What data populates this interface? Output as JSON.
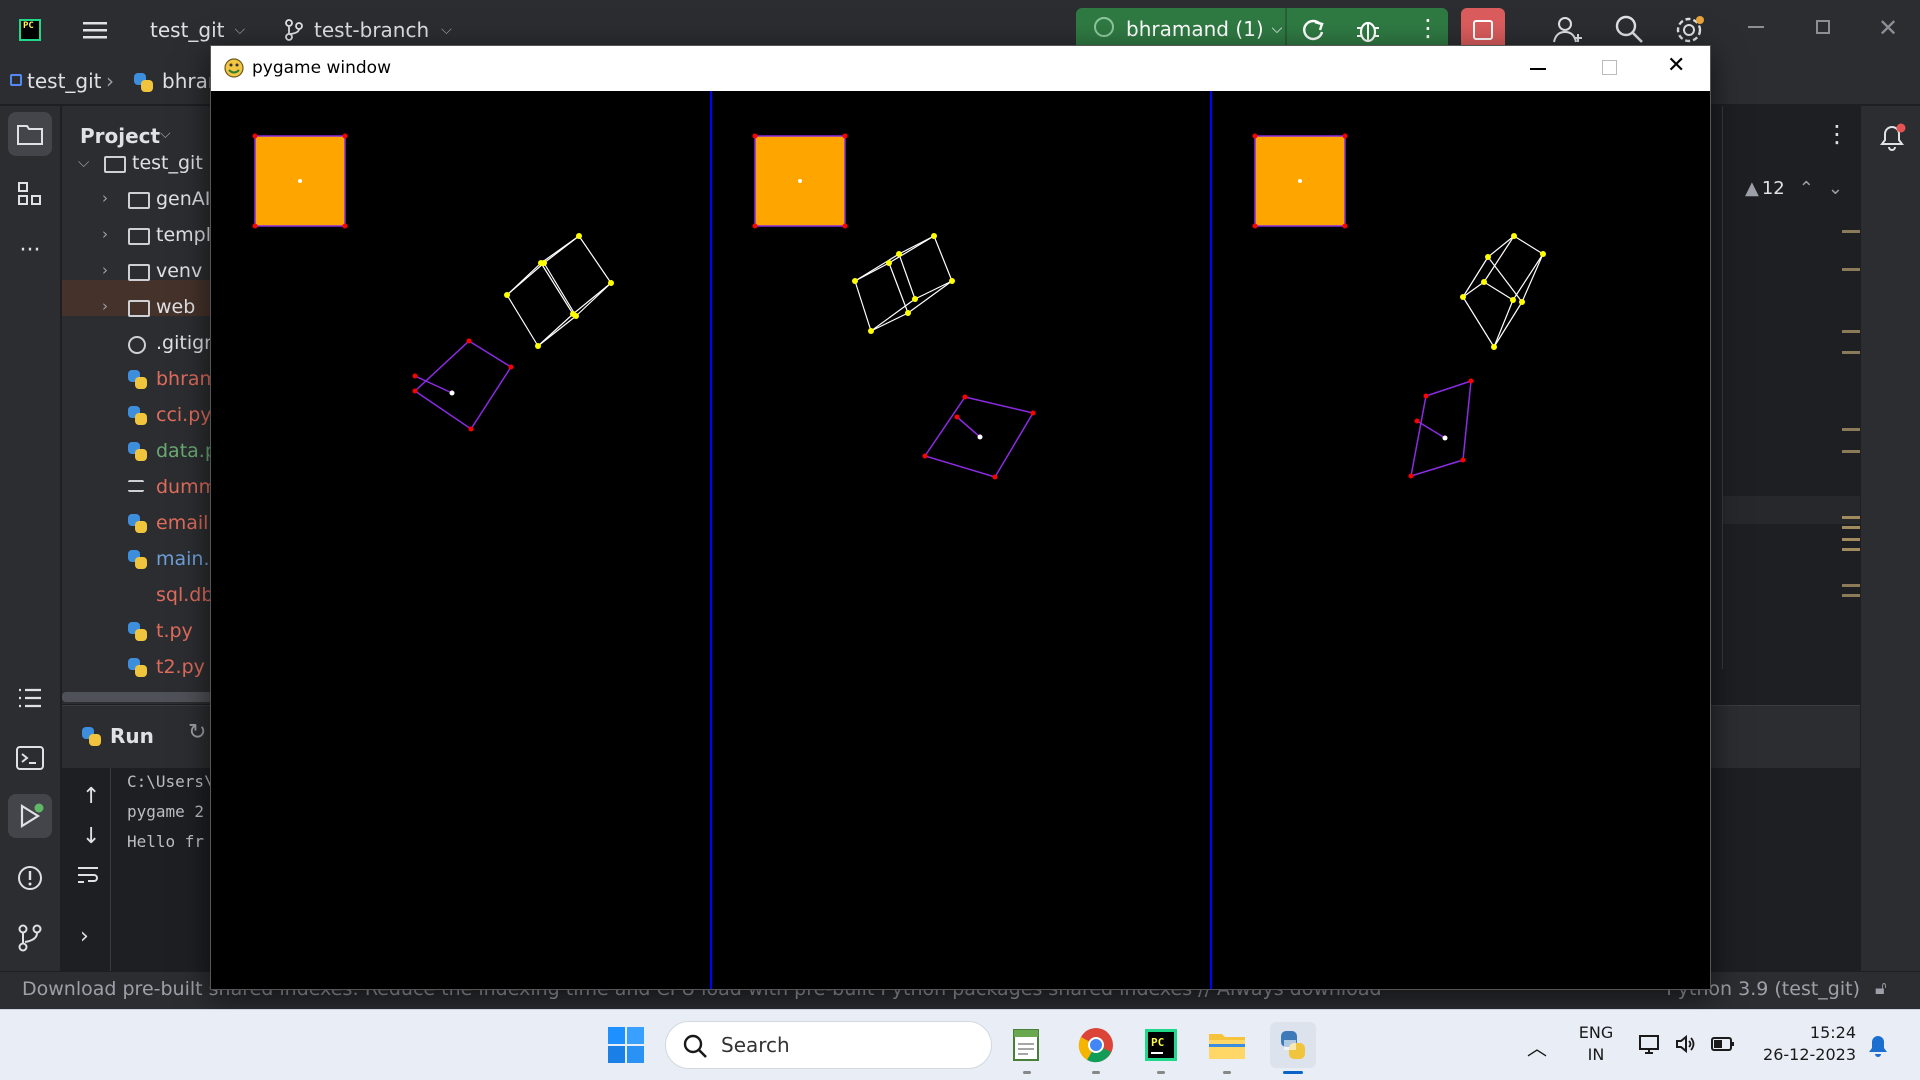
{
  "ide": {
    "project_name": "test_git",
    "branch": "test-branch",
    "run_config": "bhramand (1)",
    "breadcrumb": {
      "root": "test_git",
      "file": "bhramand"
    },
    "project_panel_title": "Project",
    "tree": [
      {
        "label": "test_git",
        "type": "root",
        "color": "#dfe1e5"
      },
      {
        "label": "genAI",
        "type": "folder",
        "color": "#dfe1e5"
      },
      {
        "label": "templates",
        "type": "folder",
        "color": "#dfe1e5"
      },
      {
        "label": "venv",
        "type": "folder",
        "color": "#dfe1e5"
      },
      {
        "label": "web",
        "type": "folder",
        "color": "#dfe1e5"
      },
      {
        "label": ".gitignore",
        "type": "ignore",
        "color": "#dfe1e5"
      },
      {
        "label": "bhramand.py",
        "type": "py",
        "color": "#e06c5c"
      },
      {
        "label": "cci.py",
        "type": "py",
        "color": "#e06c5c"
      },
      {
        "label": "data.py",
        "type": "py",
        "color": "#6aab73"
      },
      {
        "label": "dummy",
        "type": "text",
        "color": "#e06c5c"
      },
      {
        "label": "email.py",
        "type": "py",
        "color": "#e06c5c"
      },
      {
        "label": "main.py",
        "type": "py",
        "color": "#6f9fd8"
      },
      {
        "label": "sql.db",
        "type": "db",
        "color": "#e06c5c"
      },
      {
        "label": "t.py",
        "type": "py",
        "color": "#e06c5c"
      },
      {
        "label": "t2.py",
        "type": "py",
        "color": "#e06c5c"
      }
    ],
    "run_tab": "Run",
    "console": [
      "C:\\Users\\",
      "pygame 2",
      "Hello fr"
    ],
    "warnings_count": "12",
    "status_left": "Download pre-built shared indexes: Reduce the indexing time and CPU load with pre-built Python packages shared indexes // Always download",
    "status_right": "Python 3.9 (test_git)"
  },
  "pygame": {
    "title": "pygame window",
    "colors": {
      "square": "#ffa500",
      "square_outline": "#8a2be2",
      "square_vertex": "#ff0000",
      "divider": "#0000ff",
      "wireframe": "#ffffff",
      "wire_vertex": "#ffff00",
      "purple_shape": "#8a2be2"
    }
  },
  "taskbar": {
    "search_placeholder": "Search",
    "lang_top": "ENG",
    "lang_bottom": "IN",
    "time": "15:24",
    "date": "26-12-2023"
  }
}
